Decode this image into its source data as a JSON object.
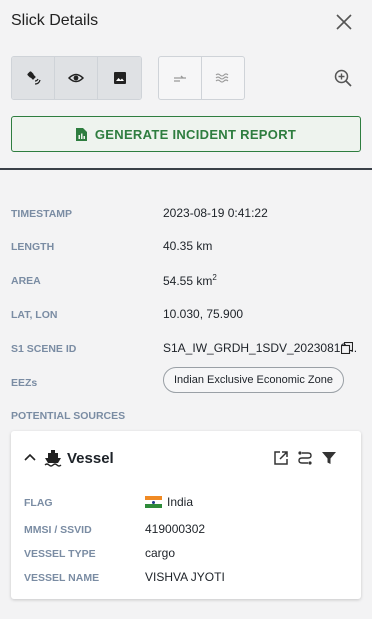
{
  "header": {
    "title": "Slick Details"
  },
  "report": {
    "label": "GENERATE INCIDENT REPORT"
  },
  "properties": {
    "timestamp": {
      "label": "TIMESTAMP",
      "value": "2023-08-19 0:41:22"
    },
    "length": {
      "label": "LENGTH",
      "value": "40.35 km"
    },
    "area": {
      "label": "AREA",
      "value": "54.55 km",
      "unit_sup": "2"
    },
    "latlon": {
      "label": "LAT, LON",
      "value": "10.030, 75.900"
    },
    "scene": {
      "label": "S1 SCENE ID",
      "value": "S1A_IW_GRDH_1SDV_20230819..."
    },
    "eez": {
      "label": "EEZs",
      "value": "Indian Exclusive Economic Zone"
    },
    "sources": {
      "label": "POTENTIAL SOURCES"
    }
  },
  "vessel": {
    "title": "Vessel",
    "flag": {
      "label": "FLAG",
      "value": "India"
    },
    "mmsi": {
      "label": "MMSI / SSVID",
      "value": "419000302"
    },
    "type": {
      "label": "VESSEL TYPE",
      "value": "cargo"
    },
    "name": {
      "label": "VESSEL NAME",
      "value": "VISHVA JYOTI"
    }
  },
  "colors": {
    "accent_green": "#2e7d3f",
    "label_gray": "#7a8ca3",
    "divider": "#3a4048"
  },
  "icons": {
    "toolbar_group_1": [
      "satellite-icon",
      "eye-icon",
      "image-icon"
    ],
    "toolbar_group_2": [
      "wind-icon",
      "waves-icon"
    ],
    "zoom": "zoom-in-icon",
    "report": "document-icon",
    "vessel": [
      "chevron-up-icon",
      "ship-icon",
      "external-link-icon",
      "route-icon",
      "filter-icon"
    ]
  }
}
